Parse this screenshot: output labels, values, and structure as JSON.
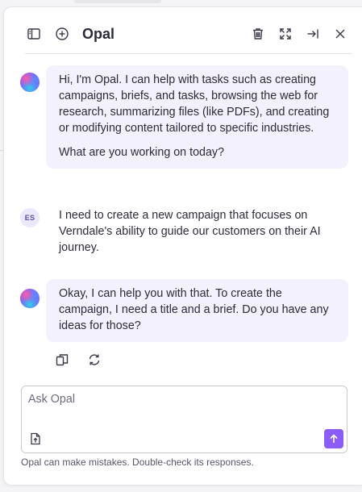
{
  "header": {
    "title": "Opal",
    "icons": {
      "left": [
        "sidebar-toggle-icon",
        "new-chat-icon"
      ],
      "right": [
        "trash-icon",
        "expand-icon",
        "dock-right-icon",
        "close-icon"
      ]
    }
  },
  "messages": [
    {
      "role": "assistant",
      "avatar": "opal-orb",
      "paragraphs": [
        "Hi, I'm Opal. I can help with tasks such as creating campaigns, briefs, and tasks, browsing the web for research, summarizing files (like PDFs), and creating or modifying content tailored to specific industries.",
        "What are you working on today?"
      ]
    },
    {
      "role": "user",
      "avatar": "ES",
      "text": "I need to create a new campaign that focuses on Verndale's ability to guide our customers on their AI journey."
    },
    {
      "role": "assistant",
      "avatar": "opal-orb",
      "paragraphs": [
        "Okay, I can help you with that. To create the campaign, I need a title and a brief. Do you have any ideas for those?"
      ]
    }
  ],
  "message_actions": [
    "copy-icon",
    "regenerate-icon"
  ],
  "composer": {
    "placeholder": "Ask Opal",
    "value": "",
    "attach_icon": "file-upload-icon",
    "send_icon": "arrow-up-icon"
  },
  "disclaimer": "Opal can make mistakes. Double-check its responses.",
  "colors": {
    "accent": "#8b5cf6",
    "assistant_bubble": "#f2f1fd",
    "user_avatar_bg": "#ece8fb",
    "text": "#2b2b3a"
  }
}
